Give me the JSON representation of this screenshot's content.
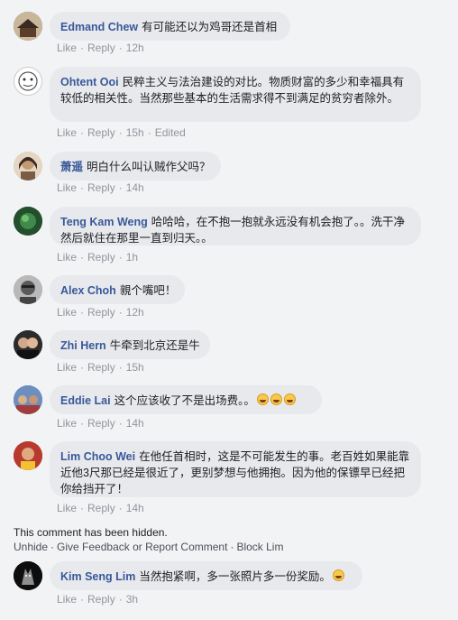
{
  "actions": {
    "like": "Like",
    "reply": "Reply",
    "sep": "·",
    "edited": "Edited"
  },
  "comments": [
    {
      "author": "Edmand Chew",
      "text": "有可能还以为鸡哥还是首相",
      "time": "12h"
    },
    {
      "author": "Ohtent Ooi",
      "text": "民粹主义与法治建设的对比。物质财富的多少和幸福具有较低的相关性。当然那些基本的生活需求得不到满足的贫穷者除外。",
      "time": "15h",
      "edited": true
    },
    {
      "author": "萧遥",
      "text": "明白什么叫认贼作父吗？",
      "time": "14h"
    },
    {
      "author": "Teng Kam Weng",
      "text": "哈哈哈，在不抱一抱就永远没有机会抱了。。洗干净然后就住在那里一直到归天。。",
      "time": "1h"
    },
    {
      "author": "Alex Choh",
      "text": "親个嘴吧！",
      "time": "12h"
    },
    {
      "author": "Zhi Hern",
      "text": "牛牵到北京还是牛",
      "time": "15h"
    },
    {
      "author": "Eddie Lai",
      "text": "这个应该收了不是出场费。。",
      "time": "14h",
      "emoji_count": 3
    },
    {
      "author": "Lim Choo Wei",
      "text": "在他任首相时，这是不可能发生的事。老百姓如果能靠近他3尺那已经是很近了，更别梦想与他拥抱。因为他的保镖早已经把你给挡开了！",
      "time": "14h"
    },
    {
      "author": "Kim Seng Lim",
      "text": "当然抱紧啊，多一张照片多一份奖励。",
      "time": "3h",
      "emoji_count": 1
    }
  ],
  "hidden": {
    "note": "This comment has been hidden.",
    "unhide": "Unhide",
    "feedback": "Give Feedback or Report Comment",
    "block": "Block Lim"
  }
}
